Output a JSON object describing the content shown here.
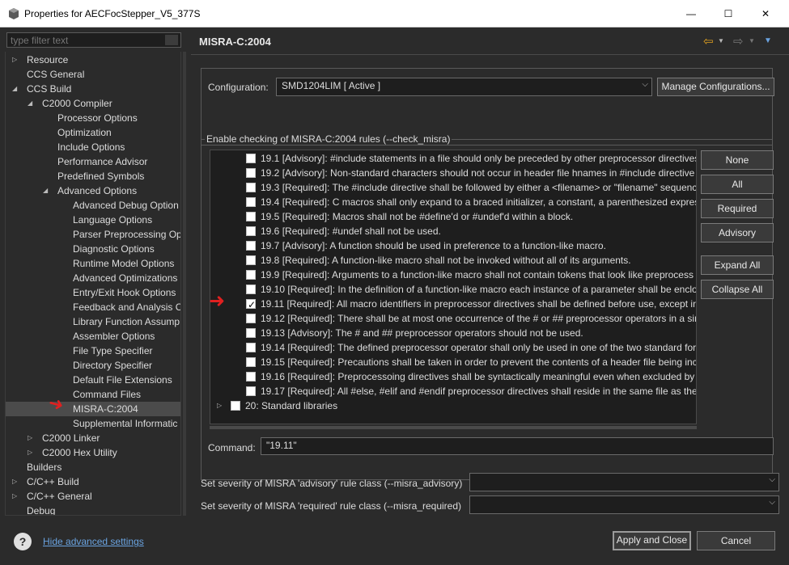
{
  "window": {
    "title": "Properties for AECFocStepper_V5_377S",
    "minimize_glyph": "—",
    "maximize_glyph": "☐",
    "close_glyph": "✕"
  },
  "sidebar": {
    "filter_placeholder": "type filter text",
    "items": [
      {
        "label": "Resource",
        "level": 0,
        "expander": "collapsed"
      },
      {
        "label": "CCS General",
        "level": 0,
        "expander": "none"
      },
      {
        "label": "CCS Build",
        "level": 0,
        "expander": "expanded"
      },
      {
        "label": "C2000 Compiler",
        "level": 1,
        "expander": "expanded"
      },
      {
        "label": "Processor Options",
        "level": 2,
        "expander": "none"
      },
      {
        "label": "Optimization",
        "level": 2,
        "expander": "none"
      },
      {
        "label": "Include Options",
        "level": 2,
        "expander": "none"
      },
      {
        "label": "Performance Advisor",
        "level": 2,
        "expander": "none"
      },
      {
        "label": "Predefined Symbols",
        "level": 2,
        "expander": "none"
      },
      {
        "label": "Advanced Options",
        "level": 2,
        "expander": "expanded"
      },
      {
        "label": "Advanced Debug Option",
        "level": 3,
        "expander": "none"
      },
      {
        "label": "Language Options",
        "level": 3,
        "expander": "none"
      },
      {
        "label": "Parser Preprocessing Op",
        "level": 3,
        "expander": "none"
      },
      {
        "label": "Diagnostic Options",
        "level": 3,
        "expander": "none"
      },
      {
        "label": "Runtime Model Options",
        "level": 3,
        "expander": "none"
      },
      {
        "label": "Advanced Optimizations",
        "level": 3,
        "expander": "none"
      },
      {
        "label": "Entry/Exit Hook Options",
        "level": 3,
        "expander": "none"
      },
      {
        "label": "Feedback and Analysis C",
        "level": 3,
        "expander": "none"
      },
      {
        "label": "Library Function Assump",
        "level": 3,
        "expander": "none"
      },
      {
        "label": "Assembler Options",
        "level": 3,
        "expander": "none"
      },
      {
        "label": "File Type Specifier",
        "level": 3,
        "expander": "none"
      },
      {
        "label": "Directory Specifier",
        "level": 3,
        "expander": "none"
      },
      {
        "label": "Default File Extensions",
        "level": 3,
        "expander": "none"
      },
      {
        "label": "Command Files",
        "level": 3,
        "expander": "none"
      },
      {
        "label": "MISRA-C:2004",
        "level": 3,
        "expander": "none",
        "selected": true
      },
      {
        "label": "Supplemental Informatic",
        "level": 3,
        "expander": "none"
      },
      {
        "label": "C2000 Linker",
        "level": 1,
        "expander": "collapsed"
      },
      {
        "label": "C2000 Hex Utility",
        "level": 1,
        "expander": "collapsed"
      },
      {
        "label": "Builders",
        "level": 0,
        "expander": "none"
      },
      {
        "label": "C/C++ Build",
        "level": 0,
        "expander": "collapsed"
      },
      {
        "label": "C/C++ General",
        "level": 0,
        "expander": "collapsed"
      },
      {
        "label": "Debug",
        "level": 0,
        "expander": "none"
      }
    ]
  },
  "page": {
    "title": "MISRA-C:2004",
    "back_glyph": "⇦",
    "forward_glyph": "⇨",
    "menu_glyph": "▼"
  },
  "configuration": {
    "label": "Configuration:",
    "value": "SMD1204LIM  [ Active ]",
    "manage_button": "Manage Configurations..."
  },
  "rules_group": {
    "legend": "Enable checking of MISRA-C:2004 rules (--check_misra)",
    "rules": [
      {
        "text": "19.1 [Advisory]: #include statements in a file should only be preceded by other preprocessor directives",
        "checked": false
      },
      {
        "text": "19.2 [Advisory]: Non-standard characters should not occur in header file hnames in #include directive",
        "checked": false
      },
      {
        "text": "19.3 [Required]: The #include directive shall be followed by either a <filename> or \"filename\" sequenc",
        "checked": false
      },
      {
        "text": "19.4 [Required]: C macros shall only expand to a braced initializer, a constant, a parenthesized express",
        "checked": false
      },
      {
        "text": "19.5 [Required]: Macros shall not be #define'd or #undef'd within a block.",
        "checked": false
      },
      {
        "text": "19.6 [Required]: #undef shall not be used.",
        "checked": false
      },
      {
        "text": "19.7 [Advisory]: A function should be used in preference to a function-like macro.",
        "checked": false
      },
      {
        "text": "19.8 [Required]: A function-like macro shall not be invoked without all of its arguments.",
        "checked": false
      },
      {
        "text": "19.9 [Required]: Arguments to a function-like macro shall not contain tokens that look like preprocess",
        "checked": false
      },
      {
        "text": "19.10 [Required]: In the definition of a function-like macro each instance of a parameter shall be enclo",
        "checked": false
      },
      {
        "text": "19.11 [Required]: All macro identifiers in preprocessor directives shall be defined before use, except in",
        "checked": true
      },
      {
        "text": "19.12 [Required]: There shall be at most one occurrence of the # or ## preprocessor operators in a sing",
        "checked": false
      },
      {
        "text": "19.13 [Advisory]: The # and ## preprocessor operators should not be used.",
        "checked": false
      },
      {
        "text": "19.14 [Required]: The defined preprocessor operator shall only be used in one of the two standard forr",
        "checked": false
      },
      {
        "text": "19.15 [Required]: Precautions shall be taken in order to prevent the contents of a header file being incl",
        "checked": false
      },
      {
        "text": "19.16 [Required]: Preprocessoing directives shall be syntactically meaningful even when excluded by t",
        "checked": false
      },
      {
        "text": "19.17 [Required]: All #else, #elif and #endif preprocessor directives shall reside in the same file as the #",
        "checked": false
      }
    ],
    "category_20": "20: Standard libraries",
    "buttons": {
      "none": "None",
      "all": "All",
      "required": "Required",
      "advisory": "Advisory",
      "expand_all": "Expand All",
      "collapse_all": "Collapse All"
    },
    "command_label": "Command:",
    "command_value": "\"19.11\""
  },
  "severity": {
    "advisory_label": "Set severity of MISRA 'advisory' rule class (--misra_advisory)",
    "advisory_value": "",
    "required_label": "Set severity of MISRA 'required' rule class (--misra_required)",
    "required_value": ""
  },
  "footer": {
    "help_glyph": "?",
    "advanced_link": "Hide advanced settings",
    "apply_close": "Apply and Close",
    "cancel": "Cancel"
  },
  "annotations": {
    "arrow_glyph": "➜",
    "color": "#e02020"
  }
}
